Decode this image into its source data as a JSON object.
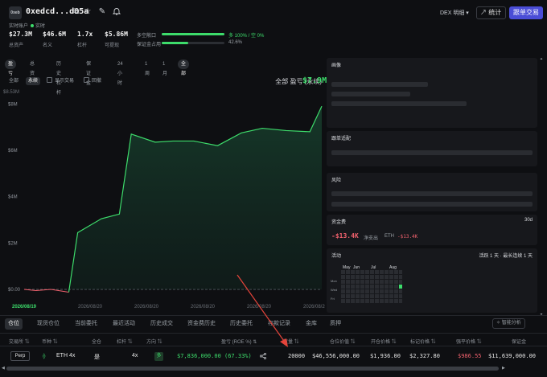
{
  "header": {
    "avatar_text": "0xeb",
    "address": "0xedcd...d05a",
    "live_label": "实时账户",
    "live_status": "实时",
    "stats": [
      {
        "value": "$27.3M",
        "label": "总资产"
      },
      {
        "value": "$46.6M",
        "label": "名义"
      },
      {
        "value": "1.7x",
        "label": "杠杆"
      },
      {
        "value": "$5.86M",
        "label": "可提现"
      }
    ],
    "long_short_label": "多空敞口",
    "long_short_text": "多 100% / 空 0%",
    "long_fraction": 1.0,
    "margin_label": "保证金占用",
    "margin_text": "42.6%",
    "margin_fraction": 0.426,
    "dex_select": "DEX 明细 ▾",
    "stats_button": "统计",
    "copy_button": "跟单交易"
  },
  "tabs": [
    "盈亏",
    "总资产",
    "历史杠杆",
    "保证金",
    "24小时",
    "1周",
    "1月",
    "全部"
  ],
  "active_tabs": [
    "盈亏",
    "全部"
  ],
  "subtabs": {
    "all": "全部",
    "perp": "永续",
    "show_trades": "显示交易",
    "drawdown": "回撤"
  },
  "pnl": {
    "title": "全部 盈亏 (永续)",
    "value": "$7.9M"
  },
  "chart_data": {
    "type": "area",
    "y_top_label": "$8.53M",
    "y_ticks": [
      {
        "label": "$8M",
        "value": 8
      },
      {
        "label": "$6M",
        "value": 6
      },
      {
        "label": "$4M",
        "value": 4
      },
      {
        "label": "$2M",
        "value": 2
      },
      {
        "label": "$0.00",
        "value": 0
      }
    ],
    "ylim": [
      0,
      8.53
    ],
    "x_ticks": [
      "2026/08/19",
      "2026/08/20",
      "2026/08/20",
      "2026/08/20",
      "2026/08/20",
      "2026/08/20"
    ],
    "series": [
      {
        "values": [
          0.0,
          -0.05,
          0.0,
          -0.12,
          2.45,
          3.05,
          3.25,
          6.7,
          6.35,
          6.4,
          6.4,
          6.2,
          6.75,
          6.95,
          6.85,
          6.8,
          7.9
        ],
        "color": "#3ddc6b"
      }
    ]
  },
  "right_panels": {
    "portrait": "画像",
    "copy_fit": "跟单适配",
    "risk": "风险",
    "funding": {
      "title": "资金费",
      "period": "30d",
      "net": "-$13.4K",
      "net_label": "净支出",
      "eth_label": "ETH",
      "eth_value": "-$13.4K"
    },
    "activity": {
      "title": "活动",
      "summary": "活跃 1 天 · 最长连续 1 天",
      "months": [
        "May",
        "Jun",
        "Jul",
        "Aug"
      ],
      "days": [
        "Mon",
        "Wed",
        "Fri"
      ]
    }
  },
  "bottom_tabs": [
    "仓位",
    "现货仓位",
    "当前委托",
    "最近活动",
    "历史成交",
    "资金费历史",
    "历史委托",
    "存款记录",
    "金库",
    "质押"
  ],
  "smart_analysis": "智能分析",
  "table": {
    "headers": [
      "交易所",
      "币种",
      "全仓",
      "杠杆",
      "方向",
      "盈亏 (ROE %)",
      "数量",
      "仓位价值",
      "开仓价格",
      "标记价格",
      "强平价格",
      "保证金"
    ],
    "row": {
      "exchange": "Perp",
      "coin": "ETH 4x",
      "cross": "是",
      "leverage": "4x",
      "side": "多",
      "pnl": "$7,836,000.00 (67.33%)",
      "size": "20000",
      "value": "$46,556,000.00",
      "entry": "$1,936.00",
      "mark": "$2,327.80",
      "liq": "$986.55",
      "margin": "$11,639,000.00"
    }
  },
  "colors": {
    "accent": "#4a4dd6",
    "green": "#3ddc6b",
    "red": "#f0616d",
    "panel": "#17181c"
  }
}
